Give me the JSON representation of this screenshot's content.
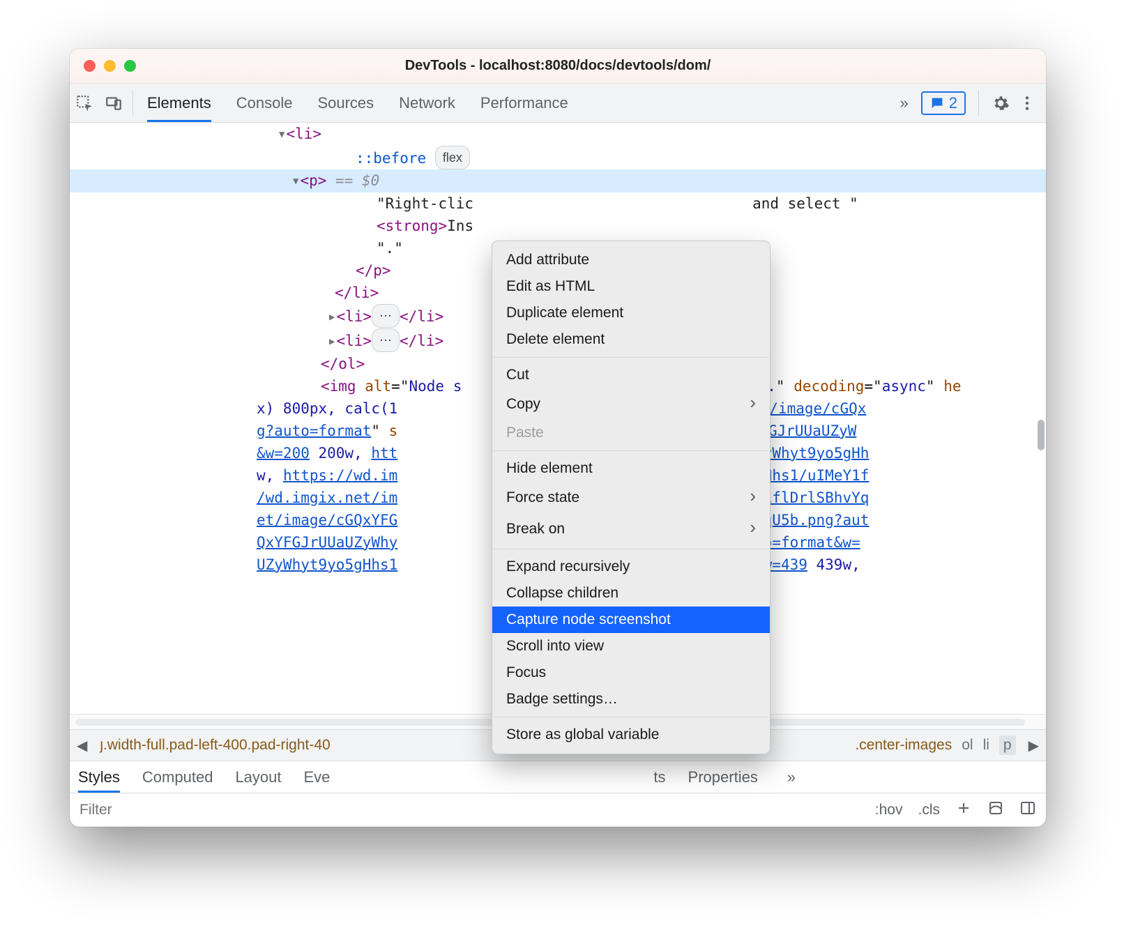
{
  "window": {
    "title": "DevTools - localhost:8080/docs/devtools/dom/"
  },
  "toolbar": {
    "tabs": [
      "Elements",
      "Console",
      "Sources",
      "Network",
      "Performance"
    ],
    "active_tab": "Elements",
    "issues_count": "2"
  },
  "dom": {
    "gutter_dots": "⋯",
    "line_li_open": "<li>",
    "line_before": "::before",
    "flex_badge": "flex",
    "line_p_open": "<p>",
    "sel_suffix": " == $0",
    "text_right_click_a": "\"Right-clic",
    "text_right_click_b": "and select \"",
    "strong_open": "<strong>",
    "strong_text": "Ins",
    "dot_text": "\".\"",
    "p_close": "</p>",
    "li_close": "</li>",
    "li_collapsed_open": "<li>",
    "ellipsis_badge": "⋯",
    "li_collapsed_close": "</li>",
    "ol_close": "</ol>",
    "img_open": "<img",
    "img_alt_name": "alt",
    "img_alt_val_a": "Node s",
    "img_alt_val_b": "ads.",
    "img_decoding_name": "decoding",
    "img_decoding_val": "async",
    "img_he": "he",
    "line_x800": "x) 800px, calc(1",
    "url_1": "//wd.imgix.net/image/cGQx",
    "url_2": "g?auto=format",
    "attr_s": " s",
    "url_3": "et/image/cGQxYFGJrUUaUZyW",
    "w200": "&w=200",
    "w200_label": " 200w, ",
    "htt": "htt",
    "url_4": "GQxYFGJrUUaUZyWhyt9yo5gHh",
    "w_label": "w, ",
    "url_5": "https://wd.im",
    "url_5b": "aUZyWhyt9yo5gHhs1/uIMeY1f",
    "url_6a": "/wd.imgix.net/im",
    "url_6b": "o5gHhs1/uIMeY1flDrlSBhvYq",
    "url_7a": "et/image/cGQxYFG",
    "url_7b": "eY1flDrlSBhvYqU5b.png?aut",
    "url_8a": "QxYFGJrUUaUZyWhy",
    "url_8b": "YqU5b.png?auto=format&w=",
    "url_9a": "UZyWhyt9yo5gHhs1",
    "url_9b": "?auto=format&w=439",
    "w439": " 439w,"
  },
  "breadcrumbs": {
    "left_trunc": "ȷ.width-full.pad-left-400.pad-right-40",
    "center": ".center-images",
    "ol": "ol",
    "li": "li",
    "p": "p"
  },
  "panes": {
    "tabs": [
      "Styles",
      "Computed",
      "Layout",
      "Eve",
      "ts",
      "Properties"
    ],
    "active": "Styles"
  },
  "styles_toolbar": {
    "filter_placeholder": "Filter",
    "hov": ":hov",
    "cls": ".cls"
  },
  "context_menu": {
    "items": [
      {
        "label": "Add attribute",
        "type": "item"
      },
      {
        "label": "Edit as HTML",
        "type": "item"
      },
      {
        "label": "Duplicate element",
        "type": "item"
      },
      {
        "label": "Delete element",
        "type": "item"
      },
      {
        "type": "sep"
      },
      {
        "label": "Cut",
        "type": "item"
      },
      {
        "label": "Copy",
        "type": "sub"
      },
      {
        "label": "Paste",
        "type": "disabled"
      },
      {
        "type": "sep"
      },
      {
        "label": "Hide element",
        "type": "item"
      },
      {
        "label": "Force state",
        "type": "sub"
      },
      {
        "label": "Break on",
        "type": "sub"
      },
      {
        "type": "sep"
      },
      {
        "label": "Expand recursively",
        "type": "item"
      },
      {
        "label": "Collapse children",
        "type": "item"
      },
      {
        "label": "Capture node screenshot",
        "type": "hot"
      },
      {
        "label": "Scroll into view",
        "type": "item"
      },
      {
        "label": "Focus",
        "type": "item"
      },
      {
        "label": "Badge settings…",
        "type": "item"
      },
      {
        "type": "sep"
      },
      {
        "label": "Store as global variable",
        "type": "item"
      }
    ]
  }
}
